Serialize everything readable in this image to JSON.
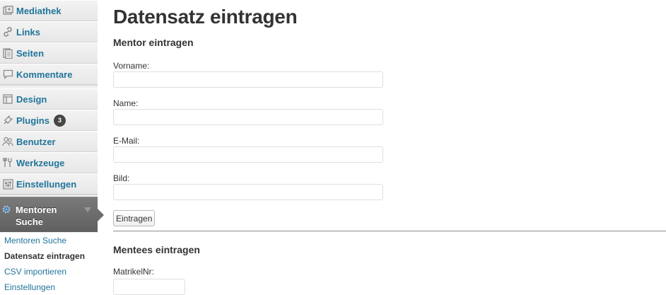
{
  "menu": {
    "items": [
      {
        "label": "Mediathek",
        "icon": "media-icon"
      },
      {
        "label": "Links",
        "icon": "links-icon"
      },
      {
        "label": "Seiten",
        "icon": "pages-icon"
      },
      {
        "label": "Kommentare",
        "icon": "comments-icon"
      },
      {
        "label": "Design",
        "icon": "appearance-icon"
      },
      {
        "label": "Plugins",
        "icon": "plugins-icon",
        "badge": "3"
      },
      {
        "label": "Benutzer",
        "icon": "users-icon"
      },
      {
        "label": "Werkzeuge",
        "icon": "tools-icon"
      },
      {
        "label": "Einstellungen",
        "icon": "settings-icon"
      }
    ],
    "active": {
      "label": "Mentoren Suche",
      "icon": "gear-icon"
    },
    "submenu": [
      "Mentoren Suche",
      "Datensatz eintragen",
      "CSV importieren",
      "Einstellungen"
    ]
  },
  "main": {
    "title": "Datensatz eintragen",
    "mentor_heading": "Mentor eintragen",
    "fields": [
      {
        "label": "Vorname:",
        "value": ""
      },
      {
        "label": "Name:",
        "value": ""
      },
      {
        "label": "E-Mail:",
        "value": ""
      },
      {
        "label": "Bild:",
        "value": ""
      }
    ],
    "submit_label": "Eintragen",
    "mentee_heading": "Mentees eintragen",
    "matrikel_label": "MatrikelNr:",
    "matrikel_value": ""
  },
  "colors": {
    "link": "#21759b",
    "active_menu_bg": "#6b6b6b",
    "text": "#333333"
  }
}
